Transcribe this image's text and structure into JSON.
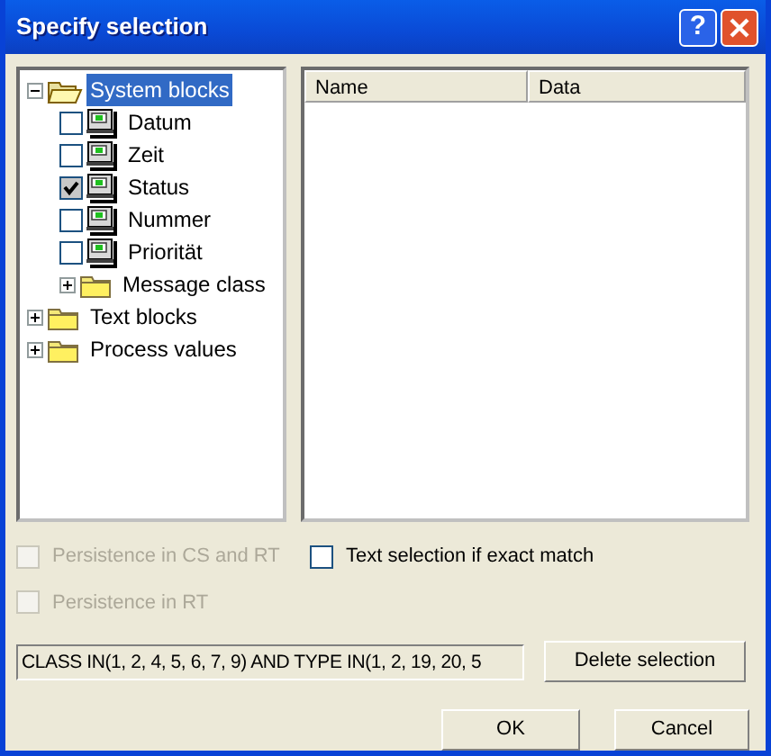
{
  "window": {
    "title": "Specify selection",
    "help": "?"
  },
  "tree": [
    {
      "label": "System blocks",
      "kind": "folder",
      "expanded": true,
      "selected": true,
      "children": [
        {
          "label": "Datum",
          "kind": "item",
          "checked": false,
          "selected": false
        },
        {
          "label": "Zeit",
          "kind": "item",
          "checked": false,
          "selected": false
        },
        {
          "label": "Status",
          "kind": "item",
          "checked": true,
          "selected": false
        },
        {
          "label": "Nummer",
          "kind": "item",
          "checked": false,
          "selected": false
        },
        {
          "label": "Priorität",
          "kind": "item",
          "checked": false,
          "selected": false
        },
        {
          "label": "Message class",
          "kind": "folder",
          "expanded": false,
          "selected": false
        }
      ]
    },
    {
      "label": "Text blocks",
      "kind": "folder",
      "expanded": false,
      "selected": false
    },
    {
      "label": "Process values",
      "kind": "folder",
      "expanded": false,
      "selected": false
    }
  ],
  "list": {
    "columns": [
      "Name",
      "Data"
    ]
  },
  "options": [
    {
      "label": "Persistence in CS and RT",
      "checked": false,
      "disabled": true
    },
    {
      "label": "Text selection if exact match",
      "checked": false,
      "disabled": false
    },
    {
      "label": "Persistence in RT",
      "checked": false,
      "disabled": true
    }
  ],
  "filter": {
    "value": "CLASS IN(1, 2, 4, 5, 6, 7, 9) AND TYPE IN(1, 2, 19, 20, 5"
  },
  "buttons": {
    "delete": "Delete selection",
    "ok": "OK",
    "cancel": "Cancel"
  }
}
